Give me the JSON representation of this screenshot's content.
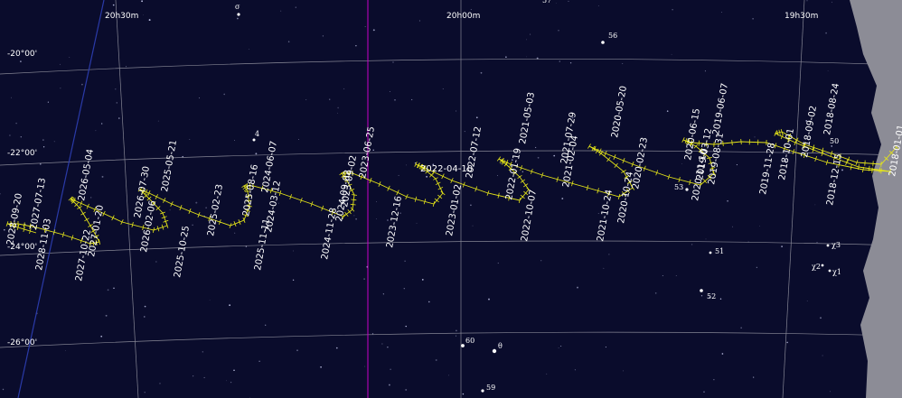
{
  "map": {
    "ra_labels": [
      "20h30m",
      "20h00m",
      "19h30m"
    ],
    "dec_labels": [
      "-20°00'",
      "-22°00'",
      "-24°00'",
      "-26°00'"
    ],
    "stars": [
      "σ",
      "57",
      "56",
      "4",
      "50",
      "53",
      "51",
      "52",
      "χ3",
      "χ2",
      "χ1",
      "60",
      "θ",
      "59"
    ],
    "dates": [
      "2018-01-01",
      "2018-08-24",
      "2018-09-02",
      "2018-12-15",
      "2019-06-07",
      "2019-03-12",
      "2019-11-28",
      "2020-06-15",
      "2020-11-10",
      "2020-05-20",
      "2020-02-23",
      "2020-10-24",
      "2021-07-29",
      "2021-05-03",
      "2021-02-04",
      "2021-10-24",
      "2022-07-12",
      "2022-01-19",
      "2022-10-07",
      "2022-04-10",
      "2023-01-02",
      "2023-06-25",
      "2023-12-16",
      "2023-09-02",
      "2024-06-07",
      "2024-03-12",
      "2024-11-28",
      "2024-09-02",
      "2025-08-16",
      "2025-05-21",
      "2025-02-23",
      "2025-11-11",
      "2025-10-25",
      "2026-07-30",
      "2026-02-06",
      "2026-05-04",
      "2027-07-13",
      "2027-01-20",
      "2027-10-22",
      "2028-09-20",
      "2028-11-03",
      "2018-10-01",
      "2019-08-31"
    ],
    "colors": {
      "sky": "#0a0c2c",
      "path": "#e6e619",
      "grid": "#c8c8c8",
      "meridian": "#c800c8",
      "horizon": "#8c8c96"
    }
  }
}
